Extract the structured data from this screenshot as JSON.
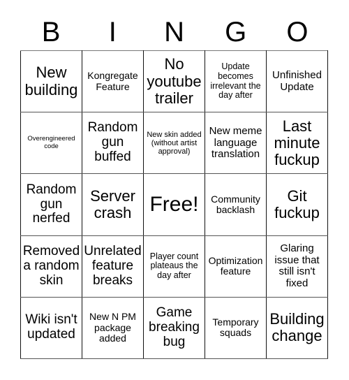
{
  "header": {
    "letters": [
      "B",
      "I",
      "N",
      "G",
      "O"
    ]
  },
  "grid": {
    "rows": [
      [
        "New building",
        "Kongregate Feature",
        "No youtube trailer",
        "Update becomes irrelevant the day after",
        "Unfinished Update"
      ],
      [
        "Overengineered code",
        "Random gun buffed",
        "New skin added (without artist approval)",
        "New meme language translation",
        "Last minute fuckup"
      ],
      [
        "Random gun nerfed",
        "Server crash",
        "Free!",
        "Community backlash",
        "Git fuckup"
      ],
      [
        "Removed a random skin",
        "Unrelated feature breaks",
        "Player count plateaus the day after",
        "Optimization feature",
        "Glaring issue that still isn't fixed"
      ],
      [
        "Wiki isn't updated",
        "New N PM package added",
        "Game breaking bug",
        "Temporary squads",
        "Building change"
      ]
    ]
  }
}
